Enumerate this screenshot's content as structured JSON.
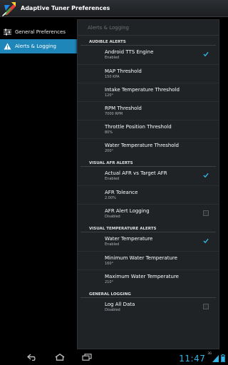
{
  "app": {
    "title": "Adaptive Tuner Preferences",
    "icon": "app-logo"
  },
  "sidebar": {
    "items": [
      {
        "label": "General Preferences",
        "icon": "sliders-icon",
        "active": false
      },
      {
        "label": "Alerts & Logging",
        "icon": "warning-icon",
        "active": true
      }
    ]
  },
  "panel": {
    "breadcrumb": "Alerts & Logging",
    "sections": [
      {
        "header": "AUDIBLE ALERTS",
        "prefs": [
          {
            "title": "Android TTS Engine",
            "summary": "Enabled",
            "checkbox": "checked"
          },
          {
            "title": "MAP Threshold",
            "summary": "150 KPA"
          },
          {
            "title": "Intake Temperature Threshold",
            "summary": "120°"
          },
          {
            "title": "RPM Threshold",
            "summary": "7000 RPM"
          },
          {
            "title": "Throttle Position Threshold",
            "summary": "80%"
          },
          {
            "title": "Water Temperature Threshold",
            "summary": "200°"
          }
        ]
      },
      {
        "header": "VISUAL AFR ALERTS",
        "prefs": [
          {
            "title": "Actual AFR vs Target AFR",
            "summary": "Enabled",
            "checkbox": "checked"
          },
          {
            "title": "AFR Toleance",
            "summary": "2.00%"
          },
          {
            "title": "AFR Alert Logging",
            "summary": "Disabled",
            "checkbox": "unchecked"
          }
        ]
      },
      {
        "header": "VISUAL TEMPERATURE ALERTS",
        "prefs": [
          {
            "title": "Water Temperature",
            "summary": "Enabled",
            "checkbox": "checked"
          },
          {
            "title": "Minimum Water Temperature",
            "summary": "160°"
          },
          {
            "title": "Maximum Water Temperature",
            "summary": "210°"
          }
        ]
      },
      {
        "header": "GENERAL LOGGING",
        "prefs": [
          {
            "title": "Log All Data",
            "summary": "Disabled",
            "checkbox": "unchecked"
          }
        ]
      }
    ]
  },
  "system_bar": {
    "buttons": [
      "back-icon",
      "home-icon",
      "recent-apps-icon"
    ],
    "clock": "11:47",
    "signal_label": "3G",
    "status_icons": [
      "signal-icon",
      "battery-icon"
    ]
  },
  "colors": {
    "accent": "#33b5e5",
    "selected": "#1f86b9",
    "panel_bg": "#202326",
    "check": "#33b5e5"
  }
}
